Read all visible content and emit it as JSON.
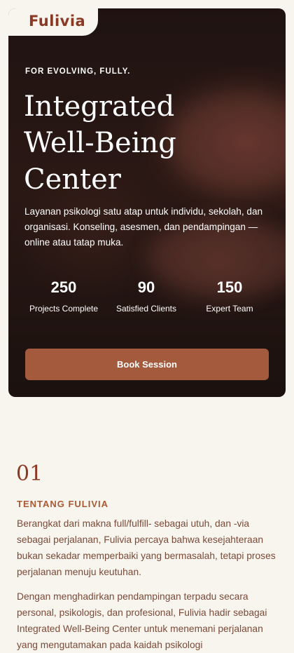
{
  "brand": {
    "name": "Fulivia"
  },
  "hero": {
    "eyebrow": "FOR EVOLVING, FULLY.",
    "title_lines": [
      "Integrated",
      "Well-Being",
      "Center"
    ],
    "description": "Layanan psikologi satu atap untuk individu, sekolah, dan organisasi. Konseling, asesmen, dan pendampingan — online atau tatap muka.",
    "stats": [
      {
        "value": "250",
        "label": "Projects Complete"
      },
      {
        "value": "90",
        "label": "Satisfied Clients"
      },
      {
        "value": "150",
        "label": "Expert Team"
      }
    ],
    "cta_label": "Book Session"
  },
  "about": {
    "number": "01",
    "title": "TENTANG FULIVIA",
    "paragraphs": [
      "Berangkat dari makna full/fulfill- sebagai utuh, dan -via sebagai perjalanan, Fulivia percaya bahwa kesejahteraan bukan sekadar memperbaiki yang bermasalah, tetapi proses perjalanan menuju keutuhan.",
      "Dengan menghadirkan pendampingan terpadu secara personal, psikologis, dan profesional, Fulivia hadir sebagai Integrated Well-Being Center untuk menemani perjalanan yang mengutamakan pada kaidah psikologi"
    ]
  },
  "colors": {
    "accent": "#a45a3c",
    "brand": "#8a3a24",
    "page_background": "#f8f4ee",
    "hero_background": "#1f1311"
  }
}
